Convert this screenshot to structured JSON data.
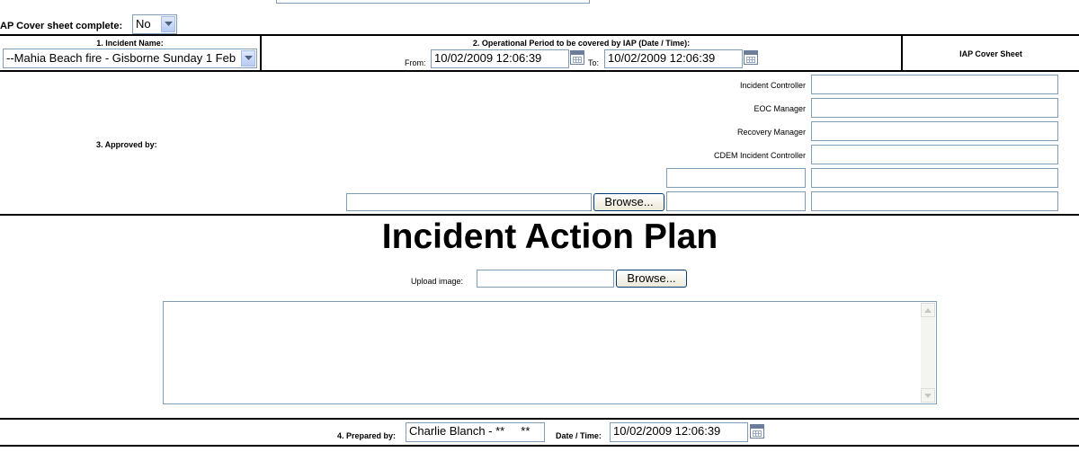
{
  "cover": {
    "label": "AP Cover sheet complete:",
    "selected": "No"
  },
  "header": {
    "incident_name_label": "1. Incident Name:",
    "incident_name_value": "--Mahia Beach fire - Gisborne Sunday 1 Feb",
    "op_period_label": "2. Operational Period to be covered by IAP (Date / Time):",
    "from_label": "From:",
    "from_value": "10/02/2009 12:06:39",
    "to_label": "To:",
    "to_value": "10/02/2009 12:06:39",
    "sheet_title": "IAP Cover Sheet"
  },
  "approved": {
    "label": "3. Approved by:",
    "roles": [
      "Incident Controller",
      "EOC Manager",
      "Recovery Manager",
      "CDEM Incident Controller"
    ],
    "browse_label": "Browse..."
  },
  "plan": {
    "title": "Incident Action Plan",
    "upload_label": "Upload image:",
    "browse_label": "Browse..."
  },
  "footer": {
    "prepared_label": "4. Prepared by:",
    "prepared_value": "Charlie Blanch - **     **",
    "datetime_label": "Date / Time:",
    "datetime_value": "10/02/2009 12:06:39"
  },
  "icons": {
    "calendar": "calendar-icon",
    "dropdown": "chevron-down-icon"
  },
  "colors": {
    "input_border": "#7f9db9",
    "dropdown_arrow": "#4d6185"
  }
}
